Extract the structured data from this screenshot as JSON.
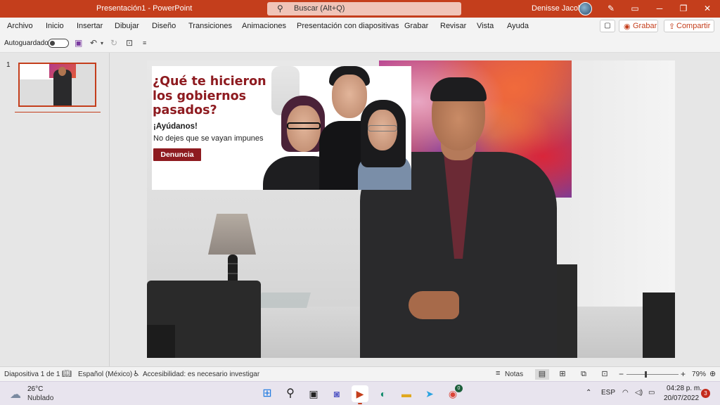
{
  "window": {
    "title": "Presentación1 - PowerPoint",
    "search_placeholder": "Buscar (Alt+Q)",
    "user_name": "Denisse Jacobo",
    "minimize_glyph": "─",
    "restore_glyph": "❐",
    "close_glyph": "✕"
  },
  "ribbon": {
    "tabs": [
      "Archivo",
      "Inicio",
      "Insertar",
      "Dibujar",
      "Diseño",
      "Transiciones",
      "Animaciones",
      "Presentación con diapositivas",
      "Grabar",
      "Revisar",
      "Vista",
      "Ayuda"
    ],
    "record_label": "Grabar",
    "share_label": "Compartir"
  },
  "qat": {
    "autosave_label": "Autoguardado",
    "autosave_on": false
  },
  "slide_pane": {
    "slide_number": "1"
  },
  "slide": {
    "banner": {
      "headline": "¿Qué te hicieron los gobiernos pasados?",
      "help": "¡Ayúdanos!",
      "subtext": "No dejes que se vayan impunes",
      "cta": "Denuncia"
    }
  },
  "statusbar": {
    "slide_count": "Diapositiva 1 de 1",
    "language": "Español (México)",
    "accessibility": "Accesibilidad: es necesario investigar",
    "notes_label": "Notas",
    "zoom_level": "79%",
    "zoom_minus": "−",
    "zoom_plus": "+"
  },
  "taskbar": {
    "temperature": "26°C",
    "condition": "Nublado",
    "language": "ESP",
    "time": "04:28 p. m.",
    "date": "20/07/2022",
    "notifications": "3",
    "chrome_badge": "0"
  },
  "colors": {
    "accent": "#c43e1c",
    "banner_red": "#8e1b20"
  }
}
